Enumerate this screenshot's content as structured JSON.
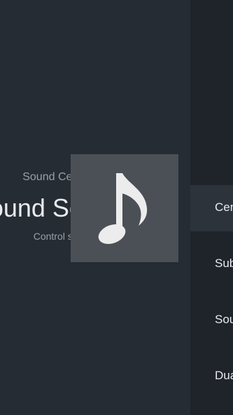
{
  "header": {
    "breadcrumb": "Sound Center Control",
    "title": "Sound Setting",
    "subtitle": "Control system sound."
  },
  "icon": {
    "name": "music-note-icon",
    "tile_color": "#4b4f56"
  },
  "menu": {
    "items": [
      {
        "label": "Center",
        "selected": true
      },
      {
        "label": "Subwoofer"
      },
      {
        "label": "Sound"
      },
      {
        "label": "Dual"
      }
    ]
  },
  "colors": {
    "background": "#262c33",
    "right_pane": "#1f242a",
    "selected_item": "#2d333a"
  }
}
